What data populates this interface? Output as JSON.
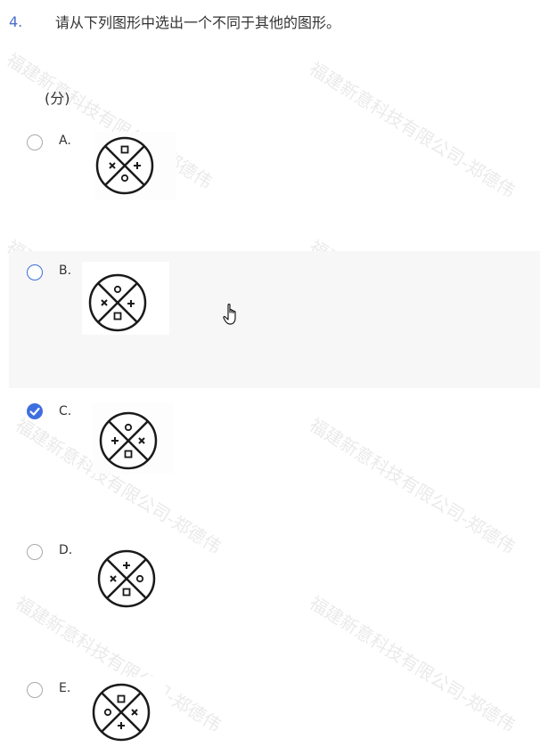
{
  "question": {
    "number": "4.",
    "text": "请从下列图形中选出一个不同于其他的图形。",
    "score": "(分)"
  },
  "options": [
    {
      "label": "A.",
      "checked": false,
      "hovered": false
    },
    {
      "label": "B.",
      "checked": false,
      "hovered": true
    },
    {
      "label": "C.",
      "checked": true,
      "hovered": false
    },
    {
      "label": "D.",
      "checked": false,
      "hovered": false
    },
    {
      "label": "E.",
      "checked": false,
      "hovered": false
    }
  ],
  "watermark": "福建新意科技有限公司-郑德伟",
  "colors": {
    "accent": "#3f6ee0",
    "question_number": "#4a6fd0",
    "hover_background": "#f7f7f7"
  }
}
